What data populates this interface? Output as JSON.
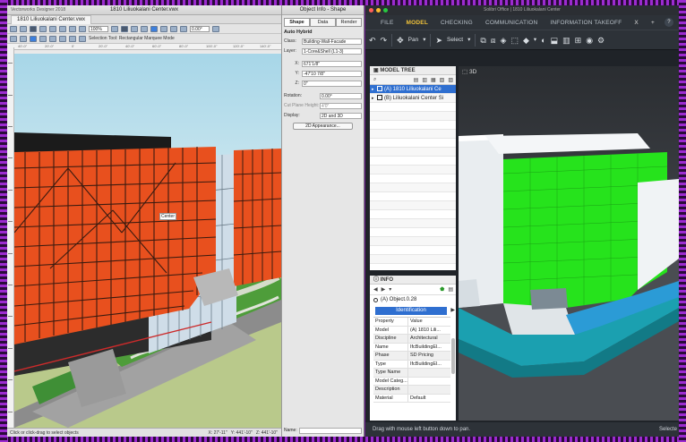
{
  "vectorworks": {
    "app_title": "Vectorworks Designer 2018",
    "window_title": "1810 Liliuokalani Center.vwx",
    "doc_tab": "1810 Liliuokalani Center.vwx",
    "zoom": "100%",
    "angle": "0.00°",
    "selection_tool_mode": "Selection Tool: Rectangular Marquee Mode",
    "ruler_marks": [
      "40'-0\"",
      "20'-0\"",
      "0'",
      "20'-0\"",
      "40'-0\"",
      "60'-0\"",
      "80'-0\"",
      "100'-0\"",
      "120'-0\"",
      "140'-0\""
    ],
    "label_center": "Center",
    "status_text": "Click or click-drag to select objects",
    "status_coords": [
      "X: 27'-11\"",
      "Y: 441'-10\"",
      "Z: 441'-10\""
    ]
  },
  "object_info": {
    "title": "Object Info - Shape",
    "tabs": [
      "Shape",
      "Data",
      "Render"
    ],
    "active_tab": "Shape",
    "heading": "Auto Hybrid",
    "class_label": "Class:",
    "class_value": "Building-Wall-Facade",
    "layer_label": "Layer:",
    "layer_value": "1-Core&Shell (L1-3)",
    "x_label": "X:",
    "x_value": "671'1/8\"",
    "y_label": "Y:",
    "y_value": "-47'10 7/8\"",
    "z_label": "Z:",
    "z_value": "0\"",
    "rotation_label": "Rotation:",
    "rotation_value": "0.00°",
    "cut_plane_label": "Cut Plane Height:",
    "cut_plane_value": "4'0\"",
    "display_label": "Display:",
    "display_value": "2D and 3D",
    "appearance_button": "2D Appearance...",
    "name_label": "Name:"
  },
  "bimcollab": {
    "window_title": "Solibri Office | 1810 Liliuokalani Center",
    "menu": [
      "FILE",
      "MODEL",
      "CHECKING",
      "COMMUNICATION",
      "INFORMATION TAKEOFF",
      "X"
    ],
    "active_menu": "MODEL",
    "pan_label": "Pan",
    "select_label": "Select",
    "model_tree_title": "MODEL TREE",
    "tree_rows": [
      {
        "label": "(A) 1810 Liliuokalani Ce",
        "selected": true
      },
      {
        "label": "(B) Liliuokalani Center Si",
        "selected": false
      }
    ],
    "view_label": "3D",
    "info_title": "INFO",
    "info_object": "(A) Object.0.28",
    "identification_label": "Identification",
    "prop_headers": [
      "Property",
      "Value"
    ],
    "properties": [
      {
        "k": "Model",
        "v": "(A) 1810 Lili..."
      },
      {
        "k": "Discipline",
        "v": "Architectural"
      },
      {
        "k": "Name",
        "v": "IfcBuildingEl..."
      },
      {
        "k": "Phase",
        "v": "SD Pricing"
      },
      {
        "k": "Type",
        "v": "IfcBuildingEl..."
      },
      {
        "k": "Type Name",
        "v": ""
      },
      {
        "k": "Model Categ...",
        "v": ""
      },
      {
        "k": "Description",
        "v": ""
      },
      {
        "k": "Material",
        "v": "Default"
      }
    ],
    "status": "Drag with mouse left button down to pan.",
    "status_right": "Selecte"
  },
  "colors": {
    "facade_orange": "#e8501e",
    "highlight_green": "#26e31c",
    "water_teal": "#1ba0b0",
    "selection_blue": "#2f6fd0",
    "active_menu_gold": "#f0c23a"
  }
}
